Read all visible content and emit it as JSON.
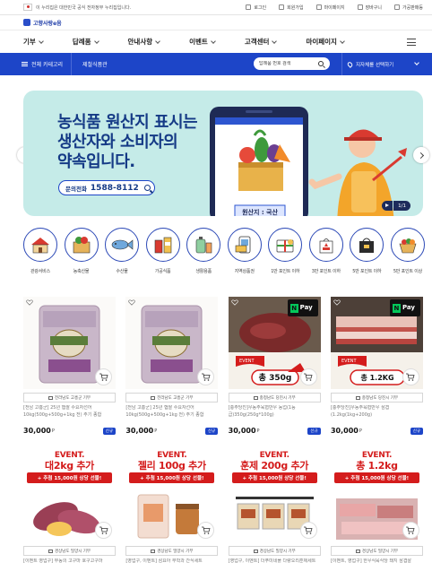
{
  "topbar": {
    "notice": "이 누리집은 대한민국 공식 전자정부 누리집입니다.",
    "links": [
      "로그인",
      "회원가입",
      "마이페이지",
      "장바구니",
      "가공판매등"
    ]
  },
  "logo": {
    "text": "고향사랑e음"
  },
  "nav": {
    "items": [
      "기부",
      "답례품",
      "안내사항",
      "이벤트",
      "고객센터",
      "마이페이지"
    ]
  },
  "catbar": {
    "all_label": "전체 카테고리",
    "link_label": "제철식품관",
    "search_placeholder": "답례품 번호 검색",
    "region_label": "지자체를 선택하기"
  },
  "banner": {
    "title": "농식품 원산지 표시는\n생산자와 소비자의\n약속입니다.",
    "phone_label": "문의전화",
    "phone_number": "1588-8112",
    "sign_text": "원산지 : 국산",
    "counter": "1/1",
    "colors": {
      "bg": "#c5ebe8",
      "title": "#153a86",
      "accent": "#1d45c8"
    }
  },
  "quick_categories": [
    {
      "label": "관광서비스",
      "icon": "tour-icon"
    },
    {
      "label": "농축산물",
      "icon": "farm-icon"
    },
    {
      "label": "수산물",
      "icon": "fish-icon"
    },
    {
      "label": "가공식품",
      "icon": "processed-food-icon"
    },
    {
      "label": "생활용품",
      "icon": "household-icon"
    },
    {
      "label": "지역상품권",
      "icon": "voucher-icon"
    },
    {
      "label": "1만 포인트 이하",
      "icon": "gift-box-icon"
    },
    {
      "label": "3만 포인트 이하",
      "icon": "gift-bag-icon"
    },
    {
      "label": "5만 포인트 이하",
      "icon": "shopping-bag-icon"
    },
    {
      "label": "5만 포인트 이상",
      "icon": "basket-icon"
    }
  ],
  "products_row1": [
    {
      "seller": "전라남도 고흥군 기부",
      "title": "[전남 고흥군] 25년 햅쌀 수요자선어 10kg(500g+500g+1kg 전) 주기 종합",
      "price": "30,000",
      "unit": "P",
      "badge": "신규"
    },
    {
      "seller": "전라남도 고흥군 기부",
      "title": "[전남 고흥군] 25년 햅쌀 수요자선어 10kg(500g+500g+1kg 전) 주기 종합",
      "price": "30,000",
      "unit": "P",
      "badge": "신규"
    },
    {
      "seller": "충청남도 당진시 기부",
      "title": "[충주당진]우농주육협반우 농업(1등급)350g(250g*100g)",
      "price": "30,000",
      "unit": "P",
      "badge": "신규",
      "event_label": "EVENT",
      "event_text": "총 350g",
      "npay": "Pay"
    },
    {
      "seller": "충청남도 당진시 기부",
      "title": "[충주당진]우농주육협반우 삼겹(1.2kg(1kg+200g)",
      "price": "30,000",
      "unit": "P",
      "badge": "신규",
      "event_label": "EVENT",
      "event_text": "총 1.2KG",
      "npay": "Pay"
    }
  ],
  "products_row2": [
    {
      "event_top": "EVENT.",
      "event_title": "대2kg 추가",
      "event_band": "+ 추첨 15,000원 상당 선물!",
      "seller": "경상남도 밀양시 기부",
      "title": "[이벤트 영업구] 부농의 고구마 호구고구마"
    },
    {
      "event_top": "EVENT.",
      "event_title": "젤리 100g 추가",
      "event_band": "+ 추첨 15,000원 상당 선물!",
      "seller": "경상남도 밀양시 기부",
      "title": "[영업구, 이벤트] 삼요아 무학과 간식세트"
    },
    {
      "event_top": "EVENT.",
      "event_title": "훈제 200g 추가",
      "event_band": "+ 추첨 15,000원 상당 선물!",
      "seller": "경상남도 밀양시 기부",
      "title": "[영업구, 이벤트] 더푸미네플 다량오리훈제세트"
    },
    {
      "event_top": "EVENT.",
      "event_title": "총 1.2kg",
      "event_band": "+ 추첨 15,000원 상당 선물!",
      "seller": "경상남도 밀양시 기부",
      "title": "[이벤트, 영업구] 한우식육식당 돼지 삼겹살"
    }
  ]
}
